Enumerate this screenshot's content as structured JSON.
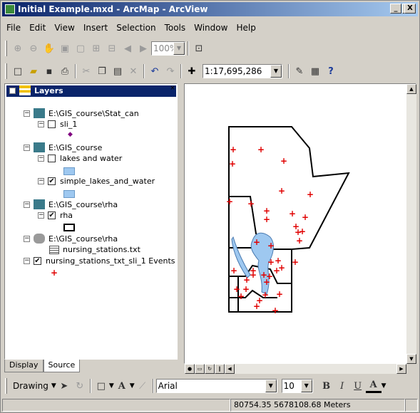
{
  "window": {
    "title": "Initial Example.mxd - ArcMap - ArcView",
    "min": "_",
    "max": "□",
    "close": "X"
  },
  "menu": [
    "File",
    "Edit",
    "View",
    "Insert",
    "Selection",
    "Tools",
    "Window",
    "Help"
  ],
  "toolbar1": {
    "zoom_value": "100%"
  },
  "toolbar2": {
    "scale_value": "1:17,695,286"
  },
  "toc": {
    "root": "Layers",
    "items": [
      {
        "label": "E:\\GIS_course\\Stat_can"
      },
      {
        "label": "sli_1"
      },
      {
        "label": "E:\\GIS_course"
      },
      {
        "label": "lakes and water"
      },
      {
        "label": "simple_lakes_and_water"
      },
      {
        "label": "E:\\GIS_course\\rha"
      },
      {
        "label": "rha"
      },
      {
        "label": "E:\\GIS_course\\rha"
      },
      {
        "label": "nursing_stations.txt"
      },
      {
        "label": "nursing_stations_txt_sli_1 Events"
      }
    ],
    "tabs": [
      "Display",
      "Source"
    ]
  },
  "drawing": {
    "label": "Drawing",
    "font": "Arial",
    "size": "10",
    "bold": "B",
    "italic": "I",
    "underline": "U",
    "textA": "A"
  },
  "status": {
    "coords": "80754.35  5678108.68 Meters"
  },
  "colors": {
    "title_start": "#0a246a",
    "title_end": "#a6caf0",
    "lake": "#9ec8f0",
    "marker": "#e00000",
    "chrome": "#d4d0c8"
  }
}
